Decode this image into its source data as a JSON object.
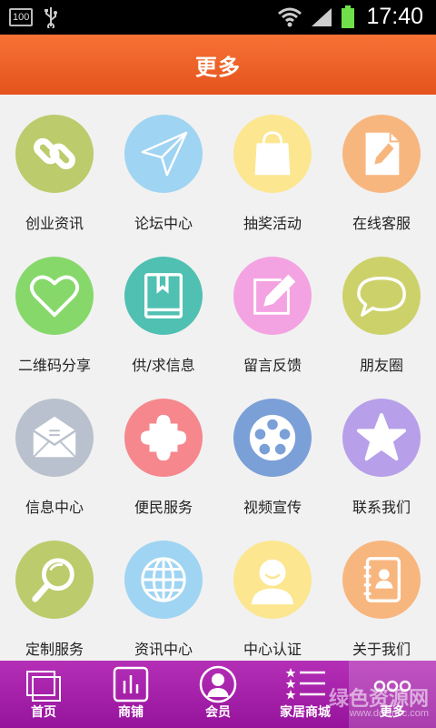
{
  "status_bar": {
    "battery_level_text": "100",
    "time": "17:40"
  },
  "header": {
    "title": "更多"
  },
  "colors": {
    "header": "#f06428",
    "bottom_nav": "#a61fa9",
    "green": "#bccb6b",
    "blue": "#9fd4f2",
    "yellow": "#fce690",
    "orange": "#f8b67f",
    "bright_green": "#86d86a",
    "teal": "#4fc0b2",
    "pink": "#f4a3e2",
    "olive": "#cdd16a",
    "grey": "#b8c1cd",
    "red": "#f5878d",
    "steel_blue": "#7b9fd7",
    "purple": "#b79fea"
  },
  "grid": {
    "items": [
      {
        "label": "创业资讯",
        "icon": "link-icon",
        "color": "#bccb6b"
      },
      {
        "label": "论坛中心",
        "icon": "paper-plane-icon",
        "color": "#9fd4f2"
      },
      {
        "label": "抽奖活动",
        "icon": "shopping-bag-icon",
        "color": "#fce690"
      },
      {
        "label": "在线客服",
        "icon": "document-edit-icon",
        "color": "#f8b67f"
      },
      {
        "label": "二维码分享",
        "icon": "heart-icon",
        "color": "#86d86a"
      },
      {
        "label": "供/求信息",
        "icon": "book-icon",
        "color": "#4fc0b2"
      },
      {
        "label": "留言反馈",
        "icon": "edit-box-icon",
        "color": "#f4a3e2"
      },
      {
        "label": "朋友圈",
        "icon": "speech-bubble-icon",
        "color": "#cdd16a"
      },
      {
        "label": "信息中心",
        "icon": "envelope-icon",
        "color": "#b8c1cd"
      },
      {
        "label": "便民服务",
        "icon": "puzzle-icon",
        "color": "#f5878d"
      },
      {
        "label": "视频宣传",
        "icon": "film-reel-icon",
        "color": "#7b9fd7"
      },
      {
        "label": "联系我们",
        "icon": "star-icon",
        "color": "#b79fea"
      },
      {
        "label": "定制服务",
        "icon": "magnifier-icon",
        "color": "#bccb6b"
      },
      {
        "label": "资讯中心",
        "icon": "globe-icon",
        "color": "#9fd4f2"
      },
      {
        "label": "中心认证",
        "icon": "user-icon",
        "color": "#fce690"
      },
      {
        "label": "关于我们",
        "icon": "contact-book-icon",
        "color": "#f8b67f"
      }
    ]
  },
  "bottom_nav": {
    "items": [
      {
        "label": "首页",
        "icon": "windows-icon"
      },
      {
        "label": "商铺",
        "icon": "bar-chart-icon"
      },
      {
        "label": "会员",
        "icon": "member-icon"
      },
      {
        "label": "家居商城",
        "icon": "star-list-icon"
      },
      {
        "label": "更多",
        "icon": "more-dots-icon"
      }
    ],
    "active_index": 4
  },
  "watermark": {
    "main": "绿色资源网",
    "sub": "www.downcc.com"
  }
}
